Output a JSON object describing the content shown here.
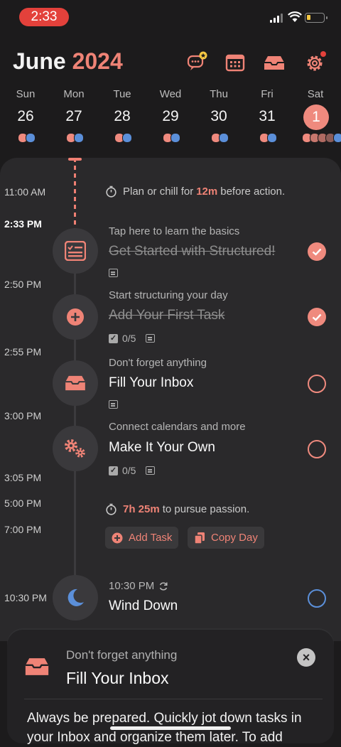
{
  "status": {
    "time": "2:33"
  },
  "header": {
    "month": "June",
    "year": "2024"
  },
  "icons": {
    "chat": "chat-star-icon",
    "calendar": "calendar-icon",
    "inbox": "inbox-icon",
    "settings": "settings-icon"
  },
  "week": [
    {
      "dow": "Sun",
      "day": "26"
    },
    {
      "dow": "Mon",
      "day": "27"
    },
    {
      "dow": "Tue",
      "day": "28"
    },
    {
      "dow": "Wed",
      "day": "29"
    },
    {
      "dow": "Thu",
      "day": "30"
    },
    {
      "dow": "Fri",
      "day": "31"
    },
    {
      "dow": "Sat",
      "day": "1"
    }
  ],
  "timeline": {
    "labels": [
      "11:00 AM",
      "2:33 PM",
      "2:50 PM",
      "2:55 PM",
      "3:00 PM",
      "3:05 PM",
      "5:00 PM",
      "7:00 PM",
      "10:30 PM"
    ],
    "gap1": {
      "prefix": "Plan or chill for",
      "highlight": "12m",
      "suffix": "before action."
    },
    "gap2": {
      "highlight": "7h 25m",
      "suffix": "to pursue passion."
    },
    "tasks": [
      {
        "subtitle": "Tap here to learn the basics",
        "title": "Get Started with Structured!"
      },
      {
        "subtitle": "Start structuring your day",
        "title": "Add Your First Task",
        "subtasks": "0/5"
      },
      {
        "subtitle": "Don't forget anything",
        "title": "Fill Your Inbox"
      },
      {
        "subtitle": "Connect calendars and more",
        "title": "Make It Your Own",
        "subtasks": "0/5"
      },
      {
        "subtitle": "10:30 PM",
        "title": "Wind Down"
      }
    ],
    "add_task": "Add Task",
    "copy_day": "Copy Day"
  },
  "sheet": {
    "subtitle": "Don't forget anything",
    "title": "Fill Your Inbox",
    "body": "Always be prepared. Quickly jot down tasks in your Inbox and organize them later. To add"
  },
  "colors": {
    "accent": "#ef8376",
    "bg": "#1c1b1c",
    "panel": "#2a292b",
    "blue": "#5b8fd9"
  }
}
